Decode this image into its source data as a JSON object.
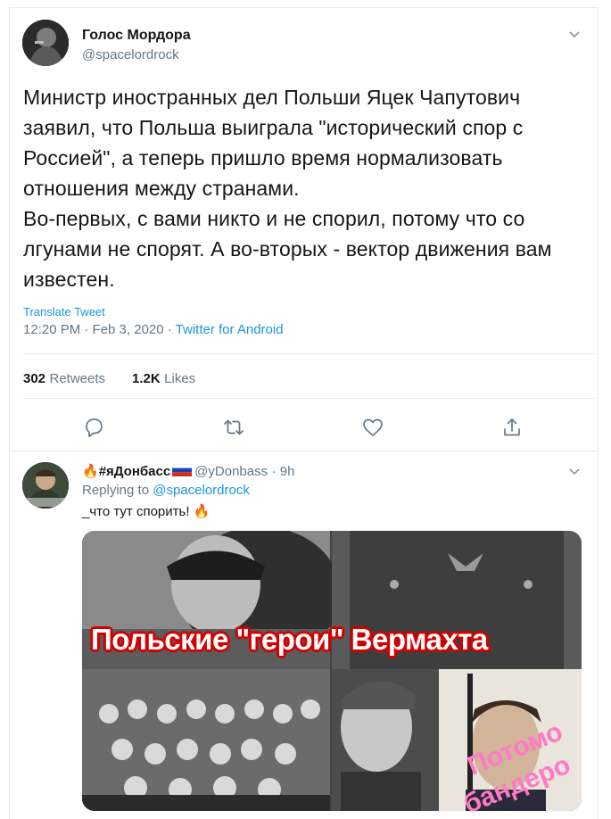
{
  "tweet": {
    "author_name": "Голос Мордора",
    "author_handle": "@spacelordrock",
    "text": "Министр иностранных дел Польши Яцек Чапутович заявил, что Польша выиграла \"исторический спор с Россией\", а теперь пришло время нормализовать отношения между странами.\nВо-первых, с вами никто и не спорил, потому что со лгунами не спорят. А во-вторых - вектор движения вам известен.",
    "translate_label": "Translate Tweet",
    "timestamp": "12:20 PM · Feb 3, 2020 · ",
    "source": "Twitter for Android",
    "retweets_count": "302",
    "retweets_label": "Retweets",
    "likes_count": "1.2K",
    "likes_label": "Likes",
    "actions": [
      "reply-icon",
      "retweet-icon",
      "like-icon",
      "share-icon"
    ]
  },
  "reply": {
    "author_name": "#яДонбасс",
    "author_handle": "@yDonbass",
    "time": "· 9h",
    "replying_to_label": "Replying to",
    "replying_to_handle": "@spacelordrock",
    "text": "_что тут спорить!",
    "image": {
      "banner": "Польские \"герои\" Вермахта",
      "overlay_line1": "Потомо",
      "overlay_line2": "бандеро"
    }
  },
  "colors": {
    "link": "#1b95e0",
    "muted": "#657786",
    "banner_stroke": "#d40000",
    "overlay_text": "#ff79c6"
  }
}
